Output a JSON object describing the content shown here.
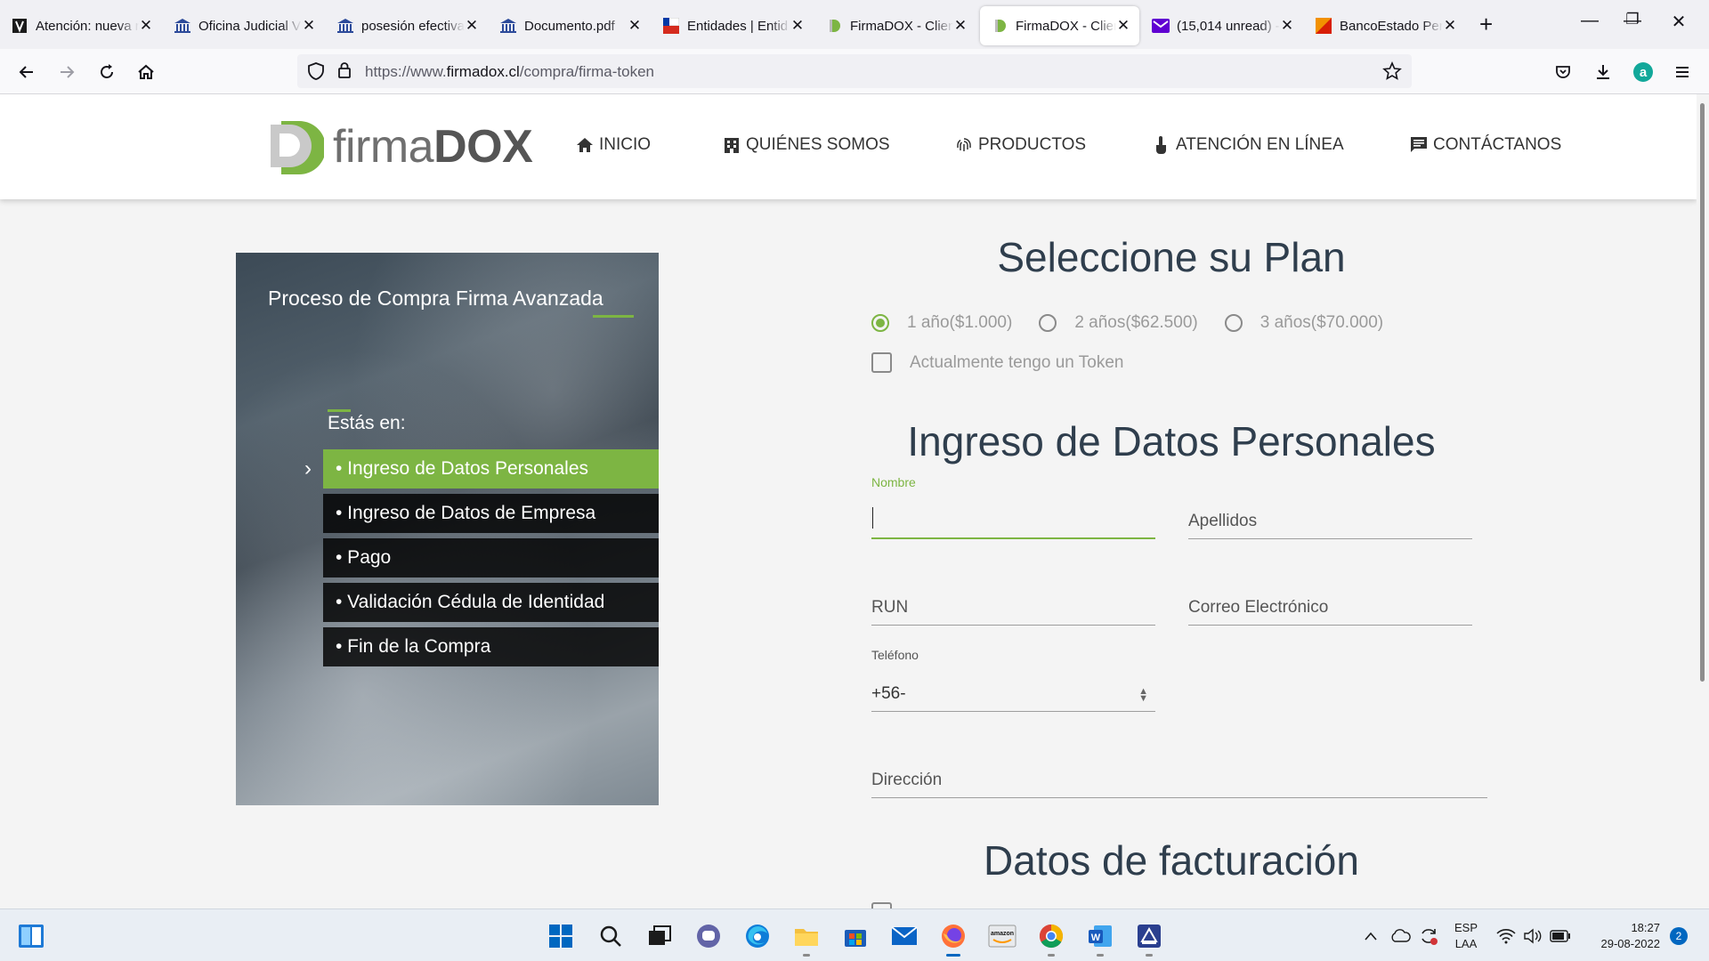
{
  "browser": {
    "tabs": [
      {
        "title": "Atención: nueva r",
        "icon": "notice-icon",
        "active": false
      },
      {
        "title": "Oficina Judicial V",
        "icon": "institution-icon",
        "active": false
      },
      {
        "title": "posesión efectiva",
        "icon": "institution-icon",
        "active": false
      },
      {
        "title": "Documento.pdf",
        "icon": "institution-icon",
        "active": false
      },
      {
        "title": "Entidades | Entid",
        "icon": "flag-icon",
        "active": false
      },
      {
        "title": "FirmaDOX - Clien",
        "icon": "firmadox-icon",
        "active": false
      },
      {
        "title": "FirmaDOX - Clien",
        "icon": "firmadox-icon",
        "active": true
      },
      {
        "title": "(15,014 unread) -",
        "icon": "mail-icon",
        "active": false
      },
      {
        "title": "BancoEstado Per",
        "icon": "bank-icon",
        "active": false
      }
    ],
    "url_prefix": "https://www.",
    "url_domain": "firmadox.cl",
    "url_path": "/compra/firma-token",
    "accent": "#0061e0"
  },
  "site": {
    "logo_light": "firma",
    "logo_bold": "DOX",
    "brand_color": "#7db543",
    "menu": {
      "inicio": "INICIO",
      "quienes": "QUIÉNES SOMOS",
      "productos": "PRODUCTOS",
      "atencion": "ATENCIÓN EN LÍNEA",
      "contacto": "CONTÁCTANOS"
    }
  },
  "process": {
    "title": "Proceso de Compra Firma Avanzada",
    "estas_en": "Estás en:",
    "steps": [
      "• Ingreso de Datos Personales",
      "• Ingreso de Datos de Empresa",
      "• Pago",
      "• Validación Cédula de Identidad",
      "• Fin de la Compra"
    ],
    "current_step": 0
  },
  "form": {
    "plan_title": "Seleccione su Plan",
    "plans": [
      "1 año($1.000)",
      "2 años($62.500)",
      "3 años($70.000)"
    ],
    "selected_plan": 0,
    "token_label": "Actualmente tengo un Token",
    "token_checked": false,
    "personal_title": "Ingreso de Datos Personales",
    "nombre_label": "Nombre",
    "apellidos_label": "Apellidos",
    "run_label": "RUN",
    "correo_label": "Correo Electrónico",
    "telefono_label": "Teléfono",
    "telefono_value": "+56-",
    "direccion_label": "Dirección",
    "billing_title": "Datos de facturación"
  },
  "taskbar": {
    "lang": "ESP",
    "layout": "LAA",
    "time": "18:27",
    "date": "29-08-2022",
    "notifications": "2"
  }
}
